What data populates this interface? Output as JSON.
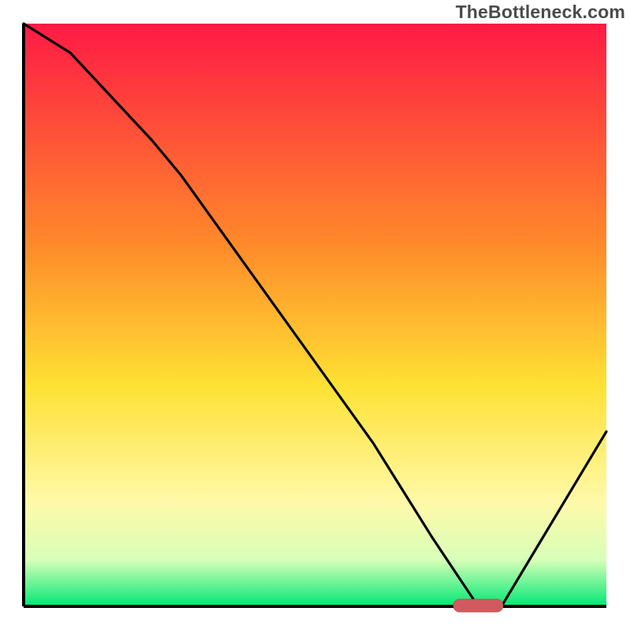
{
  "watermark": "TheBottleneck.com",
  "colors": {
    "gradient_top": "#ff1a45",
    "gradient_mid1": "#ff8a2a",
    "gradient_mid2": "#ffe133",
    "gradient_low1": "#fff9a8",
    "gradient_low2": "#d8ffb8",
    "gradient_bottom": "#00e874",
    "axis": "#000000",
    "curve": "#000000",
    "marker_fill": "#d25a5f",
    "marker_stroke": "#c34a50"
  },
  "chart_data": {
    "type": "line",
    "title": "",
    "xlabel": "",
    "ylabel": "",
    "xlim": [
      0,
      100
    ],
    "ylim": [
      0,
      100
    ],
    "series": [
      {
        "name": "bottleneck-curve",
        "x": [
          0,
          8,
          22,
          27,
          60,
          70,
          78,
          82,
          88,
          100
        ],
        "values": [
          100,
          95,
          80,
          74,
          28,
          12,
          0,
          0,
          10,
          30
        ]
      }
    ],
    "annotations": [
      {
        "name": "optimal-marker",
        "shape": "capsule",
        "x_center": 78,
        "y": 0,
        "width_x": 8.5
      }
    ]
  }
}
